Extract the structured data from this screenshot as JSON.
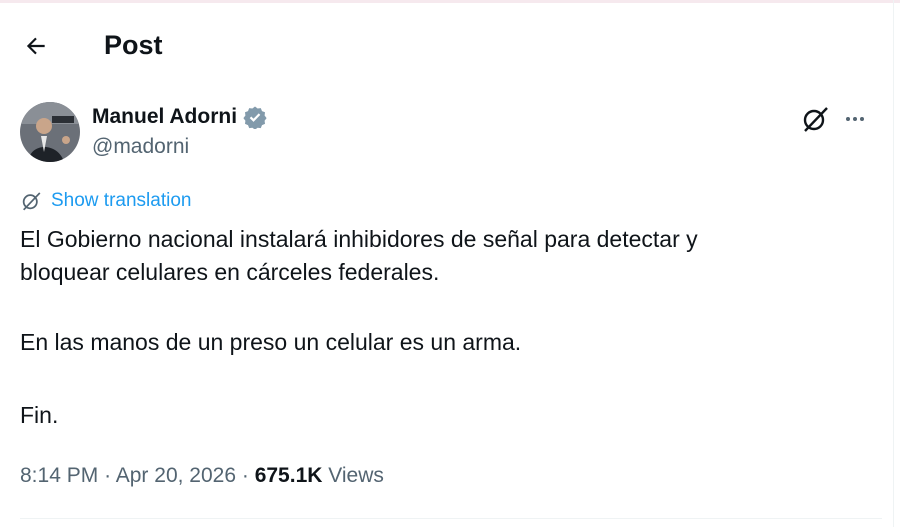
{
  "header": {
    "title": "Post"
  },
  "author": {
    "name": "Manuel Adorni",
    "handle": "@madorni",
    "verified": true
  },
  "translation": {
    "label": "Show translation"
  },
  "post": {
    "lines": [
      "El Gobierno nacional instalará inhibidores de señal para detectar y",
      "bloquear celulares en cárceles federales."
    ],
    "paragraph2": "En las manos de un preso un celular es un arma.",
    "paragraph3": "Fin."
  },
  "meta": {
    "time": "8:14 PM",
    "separator": "·",
    "date": "Apr 20, 2026",
    "views_count": "675.1K",
    "views_label": "Views"
  },
  "colors": {
    "accent": "#1d9bf0",
    "secondary_text": "#536471",
    "text": "#0f1419"
  },
  "icons": {
    "back": "arrow-left-icon",
    "verified": "verified-badge-icon",
    "grok": "grok-icon",
    "more": "more-icon",
    "translate": "translate-icon"
  }
}
